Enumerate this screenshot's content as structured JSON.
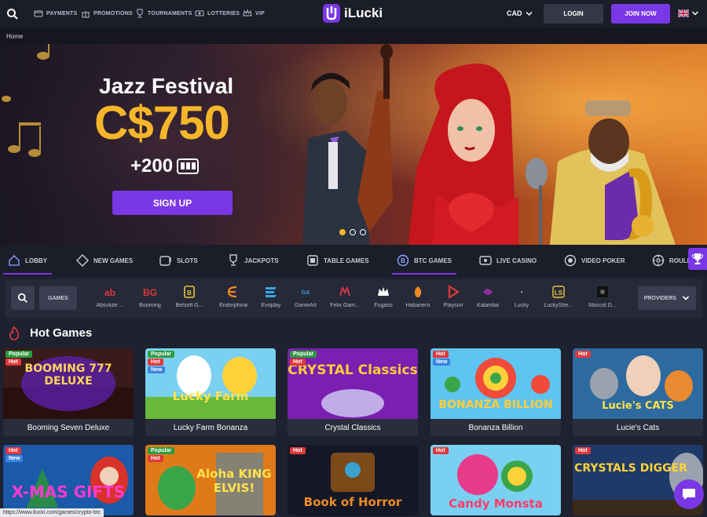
{
  "header": {
    "nav": [
      {
        "label": "PAYMENTS",
        "icon": "card-icon"
      },
      {
        "label": "PROMOTIONS",
        "icon": "gift-icon"
      },
      {
        "label": "TOURNAMENTS",
        "icon": "trophy-icon"
      },
      {
        "label": "LOTTERIES",
        "icon": "lottery-icon"
      },
      {
        "label": "VIP",
        "icon": "crown-icon"
      }
    ],
    "logo_text": "iLucki",
    "currency": "CAD",
    "login_label": "LOGIN",
    "join_label": "JOIN NOW",
    "language_flag": "uk-flag-icon"
  },
  "breadcrumb": "Home",
  "hero": {
    "title": "Jazz Festival",
    "amount": "C$750",
    "extra": "+200",
    "cta": "SIGN UP",
    "slides": 3,
    "active_slide": 1
  },
  "tabs": [
    {
      "label": "LOBBY",
      "active": true
    },
    {
      "label": "NEW GAMES",
      "active": false
    },
    {
      "label": "SLOTS",
      "active": false
    },
    {
      "label": "JACKPOTS",
      "active": false
    },
    {
      "label": "TABLE GAMES",
      "active": false
    },
    {
      "label": "BTC GAMES",
      "active": true
    },
    {
      "label": "LIVE CASINO",
      "active": false
    },
    {
      "label": "VIDEO POKER",
      "active": false
    },
    {
      "label": "ROULE",
      "active": false
    }
  ],
  "providers": {
    "games_label": "GAMES",
    "select_label": "PROVIDERS",
    "items": [
      "Absolute ...",
      "Booming",
      "Betsoft G...",
      "Endorphina",
      "Evoplay",
      "GameArt",
      "Felix Gam...",
      "Fugaso",
      "Habanero",
      "Playson",
      "Kalamba",
      "Lucky",
      "LuckyStre...",
      "Mascot G..."
    ]
  },
  "hot_games": {
    "title": "Hot Games",
    "games": [
      {
        "title": "Booming Seven Deluxe",
        "badges": [
          "Popular",
          "Hot"
        ]
      },
      {
        "title": "Lucky Farm Bonanza",
        "badges": [
          "Popular",
          "Hot",
          "New"
        ]
      },
      {
        "title": "Crystal Classics",
        "badges": [
          "Popular",
          "Hot"
        ]
      },
      {
        "title": "Bonanza Billion",
        "badges": [
          "Hot",
          "New"
        ]
      },
      {
        "title": "Lucie's Cats",
        "badges": [
          "Hot"
        ]
      },
      {
        "title": "",
        "badges": [
          "Hot",
          "New"
        ]
      },
      {
        "title": "",
        "badges": [
          "Popular",
          "Hot"
        ]
      },
      {
        "title": "",
        "badges": [
          "Hot"
        ]
      },
      {
        "title": "",
        "badges": [
          "Hot"
        ]
      },
      {
        "title": "",
        "badges": [
          "Hot"
        ]
      }
    ],
    "art_titles": [
      "BOOMING 777 DELUXE",
      "Lucky Farm",
      "CRYSTAL Classics",
      "BONANZA BILLION",
      "Lucie's CATS",
      "X-MAS GIFTS",
      "Aloha KING ELVIS!",
      "Book of Horror",
      "Candy Monsta",
      "CRYSTALS DIGGER"
    ]
  },
  "status_url": "https://www.ilucki.com/games/crypto-btc"
}
